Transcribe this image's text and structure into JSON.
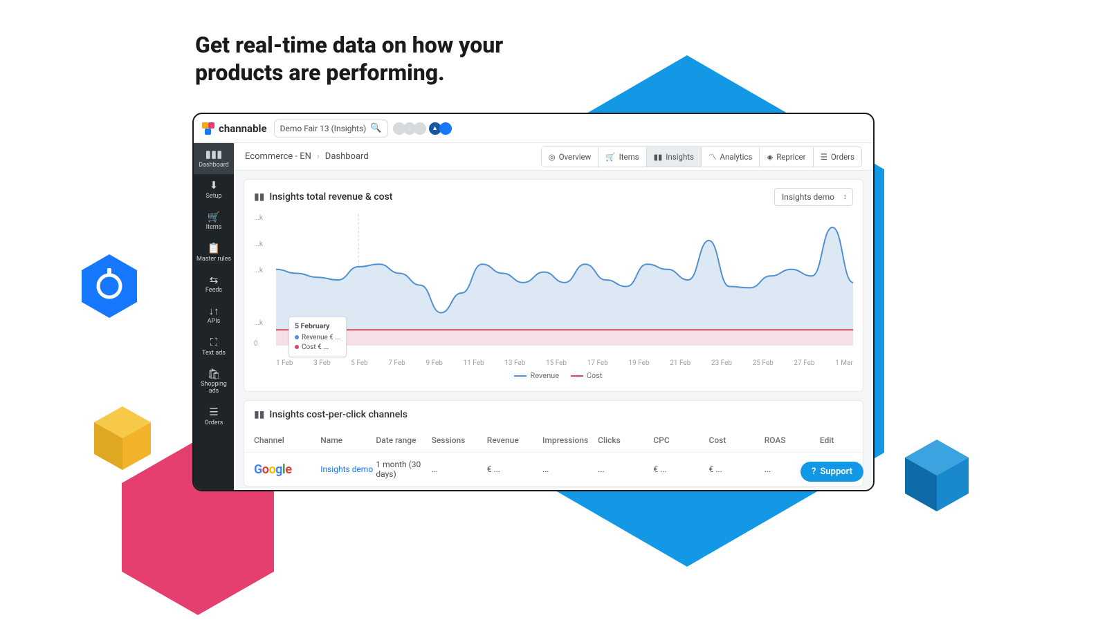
{
  "page_heading": "Get real-time data on how your\nproducts are performing.",
  "brand": "channable",
  "topbar": {
    "context": "Demo Fair 13 (Insights)"
  },
  "breadcrumb": {
    "a": "Ecommerce - EN",
    "b": "Dashboard"
  },
  "tabs": {
    "overview": "Overview",
    "items": "Items",
    "insights": "Insights",
    "analytics": "Analytics",
    "repricer": "Repricer",
    "orders": "Orders"
  },
  "sidebar": [
    {
      "icon": "▮▮▮",
      "label": "Dashboard"
    },
    {
      "icon": "⬇",
      "label": "Setup"
    },
    {
      "icon": "🛒",
      "label": "Items"
    },
    {
      "icon": "📋",
      "label": "Master rules"
    },
    {
      "icon": "⇆",
      "label": "Feeds"
    },
    {
      "icon": "↓↑",
      "label": "APIs"
    },
    {
      "icon": "⛶",
      "label": "Text ads"
    },
    {
      "icon": "🛍",
      "label": "Shopping ads"
    },
    {
      "icon": "☰",
      "label": "Orders"
    }
  ],
  "panel1": {
    "title": "Insights total revenue & cost",
    "selector": "Insights demo",
    "legend_rev": "Revenue",
    "legend_cost": "Cost",
    "tooltip_title": "5 February",
    "tooltip_rev": "Revenue € ...",
    "tooltip_cost": "Cost      € ..."
  },
  "panel2": {
    "title": "Insights cost-per-click channels",
    "headers": [
      "Channel",
      "Name",
      "Date range",
      "Sessions",
      "Revenue",
      "Impressions",
      "Clicks",
      "CPC",
      "Cost",
      "ROAS",
      "Edit"
    ],
    "row": {
      "name": "Insights demo",
      "range": "1 month (30 days)",
      "sessions": "...",
      "revenue": "€ ...",
      "impressions": "...",
      "clicks": "...",
      "cpc": "€ ...",
      "cost": "€ ...",
      "roas": "...",
      "edit": ""
    }
  },
  "support": "Support",
  "chart_data": {
    "type": "line",
    "title": "Insights total revenue & cost",
    "ylabel": "",
    "ylim": [
      0,
      100
    ],
    "yticks": [
      "0",
      "...k",
      "...k",
      "...k",
      "...k"
    ],
    "categories": [
      "1 Feb",
      "3 Feb",
      "5 Feb",
      "7 Feb",
      "9 Feb",
      "11 Feb",
      "13 Feb",
      "15 Feb",
      "17 Feb",
      "19 Feb",
      "21 Feb",
      "23 Feb",
      "25 Feb",
      "27 Feb",
      "1 Mar"
    ],
    "series": [
      {
        "name": "Revenue",
        "color": "#4f8fcf",
        "values": [
          58,
          55,
          52,
          50,
          60,
          62,
          55,
          46,
          25,
          40,
          62,
          55,
          48,
          56,
          48,
          62,
          50,
          45,
          62,
          58,
          50,
          80,
          45,
          44,
          53,
          58,
          53,
          90,
          48
        ]
      },
      {
        "name": "Cost",
        "color": "#d04b62",
        "values": [
          12,
          12,
          12,
          12,
          12,
          12,
          12,
          12,
          12,
          12,
          12,
          12,
          12,
          12,
          12,
          12,
          12,
          12,
          12,
          12,
          12,
          12,
          12,
          12,
          12,
          12,
          12,
          12,
          12
        ]
      }
    ]
  }
}
